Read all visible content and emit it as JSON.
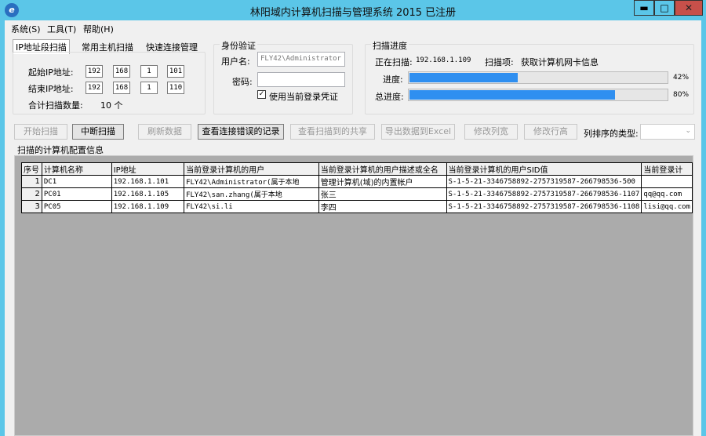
{
  "window": {
    "title": "林阳域内计算机扫描与管理系统 2015 已注册",
    "minimize": "▬",
    "maximize": "□",
    "close": "✕"
  },
  "menu": [
    "系统(S)",
    "工具(T)",
    "帮助(H)"
  ],
  "tabs": [
    "IP地址段扫描",
    "常用主机扫描",
    "快速连接管理"
  ],
  "ip_range": {
    "start_label": "起始IP地址:",
    "end_label": "结束IP地址:",
    "start": [
      "192",
      "168",
      "1",
      "101"
    ],
    "end": [
      "192",
      "168",
      "1",
      "110"
    ],
    "count_label": "合计扫描数量:",
    "count": "10 个"
  },
  "auth": {
    "title": "身份验证",
    "user_label": "用户名:",
    "user_value": "FLY42\\Administrator",
    "password_label": "密码:",
    "password_value": "",
    "use_current_label": "使用当前登录凭证",
    "use_current": true
  },
  "progress": {
    "title": "扫描进度",
    "scanning_label": "正在扫描:",
    "scanning_ip": "192.168.1.109",
    "item_label": "扫描项:",
    "item": "获取计算机网卡信息",
    "progress_label": "进度:",
    "progress_percent": 42,
    "progress_text": "42%",
    "total_label": "总进度:",
    "total_percent": 80,
    "total_text": "80%"
  },
  "buttons": [
    "开始扫描",
    "中断扫描",
    "刷新数据",
    "查看连接错误的记录",
    "查看扫描到的共享",
    "导出数据到Excel",
    "修改列宽",
    "修改行高"
  ],
  "sort_label": "列排序的类型:",
  "sort_value": "",
  "table": {
    "title": "扫描的计算机配置信息",
    "columns": [
      "序号",
      "计算机名称",
      "IP地址",
      "当前登录计算机的用户",
      "当前登录计算机的用户描述或全名",
      "当前登录计算机的用户SID值",
      "当前登录计"
    ],
    "rows": [
      [
        "1",
        "DC1",
        "192.168.1.101",
        "FLY42\\Administrator(属于本地",
        "管理计算机(域)的内置帐户",
        "S-1-5-21-3346758892-2757319587-266798536-500",
        ""
      ],
      [
        "2",
        "PC01",
        "192.168.1.105",
        "FLY42\\san.zhang(属于本地",
        "张三",
        "S-1-5-21-3346758892-2757319587-266798536-1107",
        "qq@qq.com"
      ],
      [
        "3",
        "PC05",
        "192.168.1.109",
        "FLY42\\si.li",
        "李四",
        "S-1-5-21-3346758892-2757319587-266798536-1108",
        "lisi@qq.com"
      ]
    ]
  },
  "colors": {
    "titlebar": "#5bc6e8",
    "close": "#c7504a",
    "progress": "#2f8ff0"
  }
}
